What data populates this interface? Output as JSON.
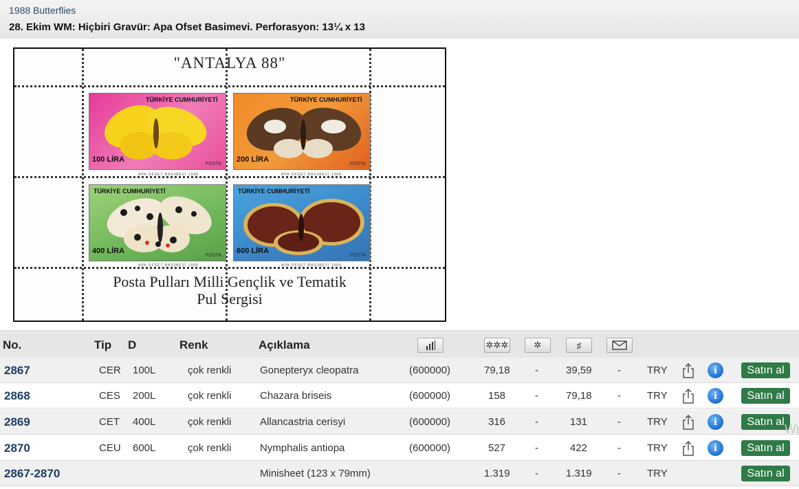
{
  "header": {
    "breadcrumb": "1988 Butterflies",
    "title": "28. Ekim WM: Hiçbiri Gravür: Apa Ofset Basimevi. Perforasyon: 13¼ x 13"
  },
  "sheet": {
    "top_text": "\"ANTALYA 88\"",
    "bottom_line1": "Posta Pulları Milli Gençlik ve Tematik",
    "bottom_line2": "Pul Sergisi",
    "stamps": [
      {
        "country": "TÜRKİYE CUMHURİYETİ",
        "value": "100 LİRA",
        "posta": "POSTA",
        "footer": "APA OFSET BASIMEVİ        1988"
      },
      {
        "country": "TÜRKİYE CUMHURİYETİ",
        "value": "200 LİRA",
        "posta": "POSTA",
        "footer": "APA OFSET BASIMEVİ        1988"
      },
      {
        "country": "TÜRKİYE CUMHURİYETİ",
        "value": "400 LİRA",
        "posta": "POSTA",
        "footer": "APA OFSET BASIMEVİ        1988"
      },
      {
        "country": "TÜRKİYE CUMHURİYETİ",
        "value": "600 LİRA",
        "posta": "POSTA",
        "footer": "APA OFSET BASIMEVİ        1988"
      }
    ]
  },
  "table": {
    "headers": {
      "no": "No.",
      "tip": "Tip",
      "d": "D",
      "renk": "Renk",
      "aciklama": "Açıklama"
    },
    "header_icons": [
      "quantity-chart-icon",
      "mint-never-hinged-icon",
      "mint-hinged-icon",
      "used-icon",
      "cover-icon"
    ],
    "rows": [
      {
        "no": "2867",
        "tip": "CER",
        "d": "100L",
        "renk": "çok renkli",
        "aciklama": "Gonepteryx cleopatra",
        "adet": "(600000)",
        "c1": "79,18",
        "c2": "-",
        "c3": "39,59",
        "c4": "-",
        "currency": "TRY",
        "buy": "Satın al"
      },
      {
        "no": "2868",
        "tip": "CES",
        "d": "200L",
        "renk": "çok renkli",
        "aciklama": "Chazara briseis",
        "adet": "(600000)",
        "c1": "158",
        "c2": "-",
        "c3": "79,18",
        "c4": "-",
        "currency": "TRY",
        "buy": "Satın al"
      },
      {
        "no": "2869",
        "tip": "CET",
        "d": "400L",
        "renk": "çok renkli",
        "aciklama": "Allancastria cerisyi",
        "adet": "(600000)",
        "c1": "316",
        "c2": "-",
        "c3": "131",
        "c4": "-",
        "currency": "TRY",
        "buy": "Satın al"
      },
      {
        "no": "2870",
        "tip": "CEU",
        "d": "600L",
        "renk": "çok renkli",
        "aciklama": "Nymphalis antiopa",
        "adet": "(600000)",
        "c1": "527",
        "c2": "-",
        "c3": "422",
        "c4": "-",
        "currency": "TRY",
        "buy": "Satın al"
      }
    ],
    "summary": {
      "no": "2867-2870",
      "aciklama": "Minisheet (123 x 79mm)",
      "c1": "1.319",
      "c2": "-",
      "c3": "1.319",
      "c4": "-",
      "currency": "TRY",
      "buy": "Satın al"
    }
  },
  "watermark": "Wi"
}
